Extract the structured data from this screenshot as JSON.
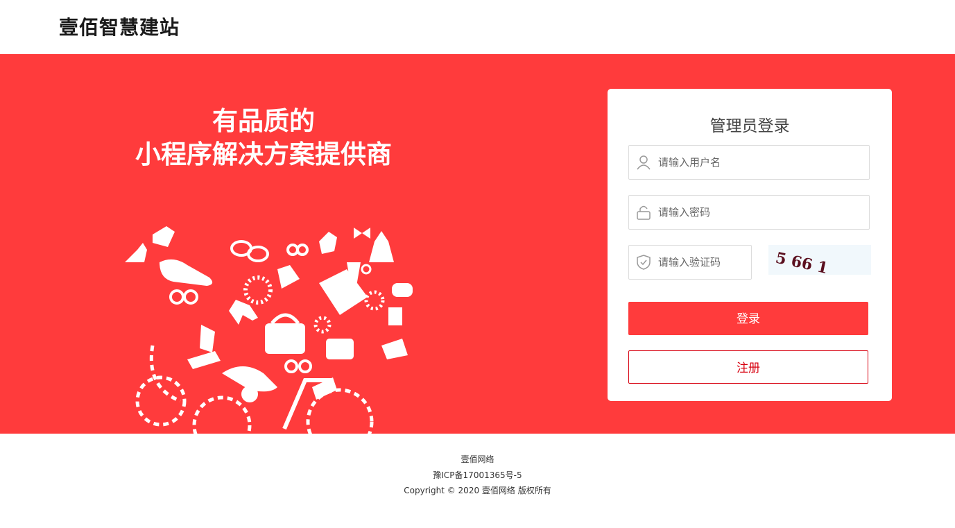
{
  "header": {
    "site_name": "壹佰智慧建站"
  },
  "banner": {
    "slogan_line1": "有品质的",
    "slogan_line2": "小程序解决方案提供商",
    "background_color": "#ff3b3c"
  },
  "login": {
    "title": "管理员登录",
    "username_placeholder": "请输入用户名",
    "password_placeholder": "请输入密码",
    "captcha_placeholder": "请输入验证码",
    "captcha_text": "5 66 1",
    "login_button": "登录",
    "register_button": "注册",
    "icons": {
      "username": "user-icon",
      "password": "lock-icon",
      "captcha": "shield-check-icon"
    }
  },
  "footer": {
    "company": "壹佰网络",
    "icp": "豫ICP备17001365号-5",
    "copyright": "Copyright © 2020 壹佰网络 版权所有"
  },
  "colors": {
    "accent": "#ff3b3c",
    "register_border": "#d7000f",
    "captcha_bg": "#f1f8fc"
  }
}
